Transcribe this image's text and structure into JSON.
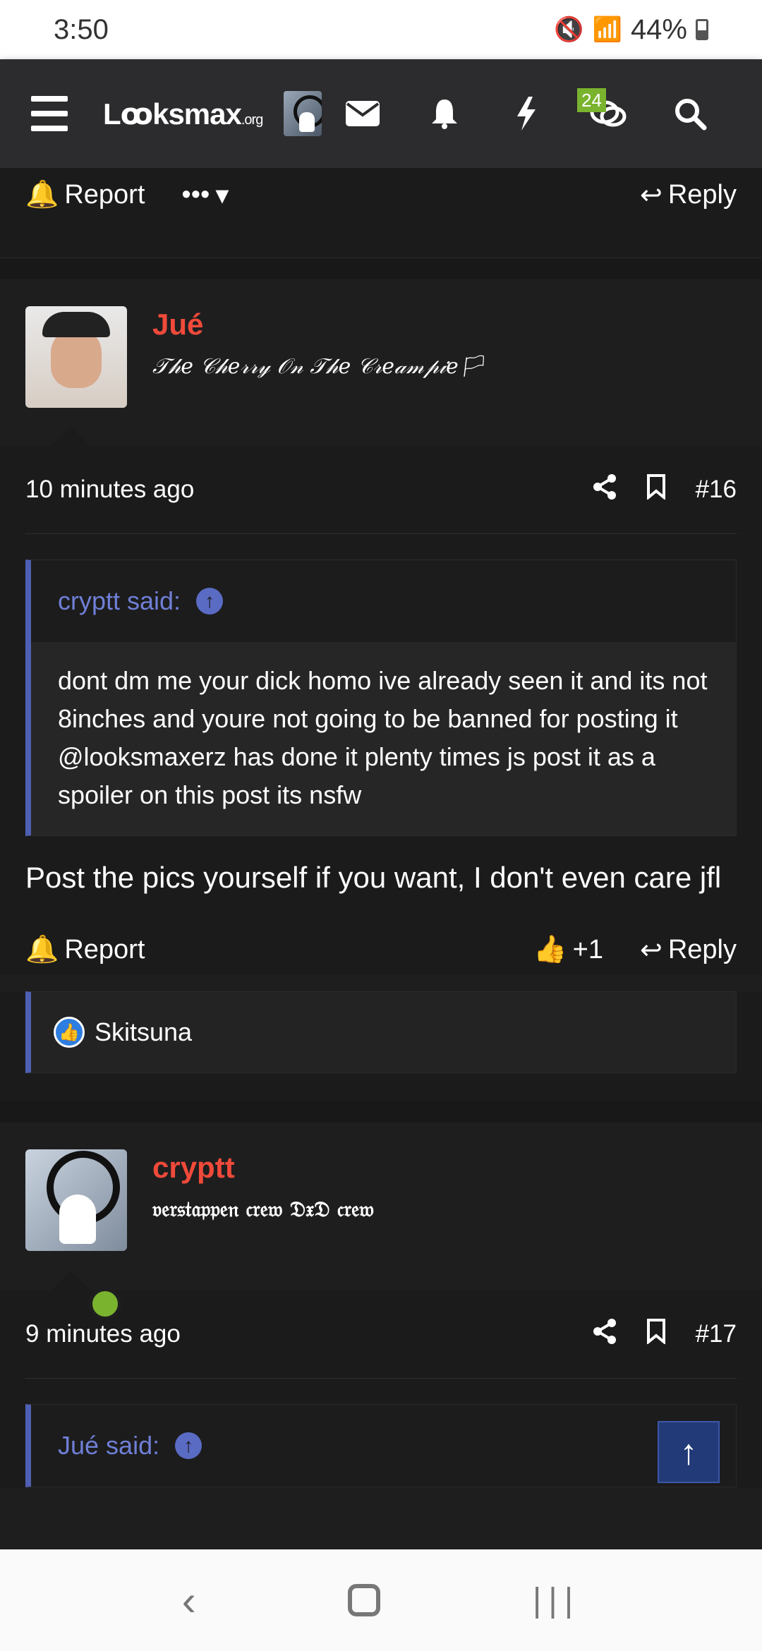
{
  "status_bar": {
    "time": "3:50",
    "battery": "44%",
    "icons": [
      "mute-icon",
      "wifi-icon",
      "signal-icon",
      "battery-icon"
    ]
  },
  "navbar": {
    "logo_main": "Lꝏksmax",
    "logo_suffix": ".org",
    "alerts_badge": "24",
    "icons": [
      "menu-icon",
      "avatar",
      "mail-icon",
      "bell-icon",
      "lightning-icon",
      "conversations-icon",
      "search-icon"
    ]
  },
  "top_actions": {
    "report": "Report",
    "more": "•••",
    "reply": "Reply"
  },
  "posts": [
    {
      "username": "Jué",
      "user_title": "𝒯𝒽𝑒 𝒞𝒽𝑒𝓇𝓇𝓎 𝒪𝓃 𝒯𝒽𝑒 𝒞𝓇𝑒𝒶𝓂𝓅𝒾𝑒🏳",
      "time": "10 minutes ago",
      "number": "#16",
      "quote_author": "cryptt said:",
      "quote_text": "dont dm me your dick homo ive already seen it and its not 8inches and youre not going to be banned for posting it @looksmaxerz has done it plenty times js post it as a spoiler on this post its nsfw",
      "message": "Post the pics yourself if you want, I don't even care jfl",
      "report": "Report",
      "like_count": "+1",
      "reply": "Reply",
      "reaction_user": "Skitsuna"
    },
    {
      "username": "cryptt",
      "user_title": "𝔳𝔢𝔯𝔰𝔱𝔞𝔭𝔭𝔢𝔫 𝔠𝔯𝔢𝔴 𝔇𝔵𝔇 𝔠𝔯𝔢𝔴",
      "time": "9 minutes ago",
      "number": "#17",
      "quote_author": "Jué said:"
    }
  ],
  "colors": {
    "username": "#f04a3a",
    "quote_accent": "#4f5fb3",
    "badge": "#7ab32e",
    "online": "#7ab32e"
  }
}
